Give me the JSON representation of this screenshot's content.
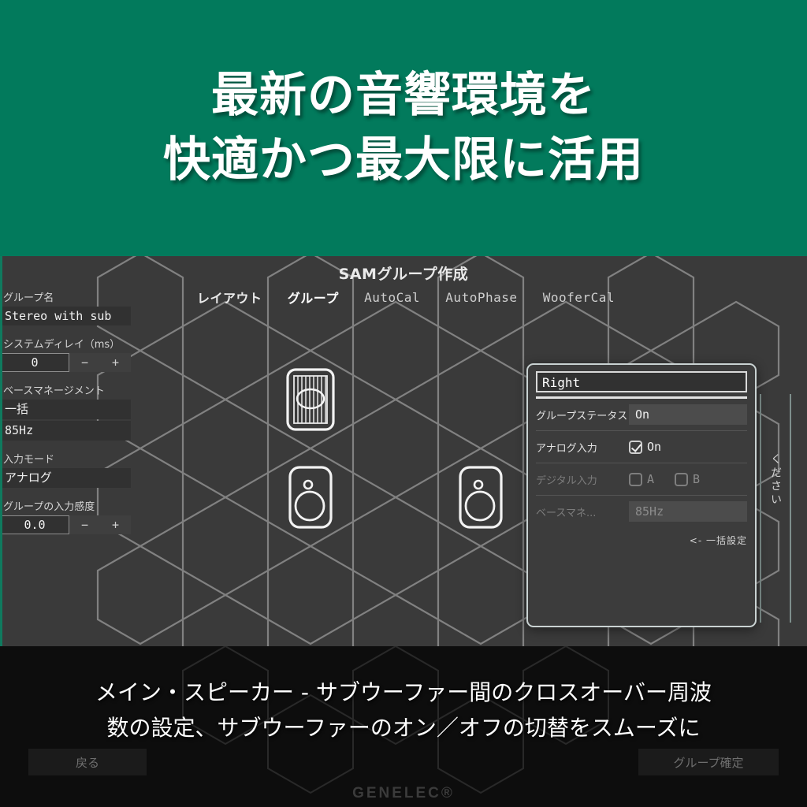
{
  "hero": {
    "line1": "最新の音響環境を",
    "line2": "快適かつ最大限に活用",
    "bg_color": "#027a5c",
    "text_color": "#ffffff"
  },
  "app": {
    "title": "SAMグループ作成",
    "tabs": [
      {
        "label": "レイアウト",
        "active": false,
        "script": "jp"
      },
      {
        "label": "グループ",
        "active": true,
        "script": "jp"
      },
      {
        "label": "AutoCal",
        "active": false,
        "script": "latin"
      },
      {
        "label": "AutoPhase",
        "active": false,
        "script": "latin"
      },
      {
        "label": "WooferCal",
        "active": false,
        "script": "latin"
      }
    ],
    "sidebar": {
      "group_name_label": "グループ名",
      "group_name_value": "Stereo with sub",
      "system_delay_label": "システムディレイ（ms）",
      "system_delay_value": "0",
      "minus": "−",
      "plus": "+",
      "bass_management_label": "ベースマネージメント",
      "bass_management_mode": "一括",
      "bass_management_freq": "85Hz",
      "input_mode_label": "入力モード",
      "input_mode_value": "アナログ",
      "group_sensitivity_label": "グループの入力感度",
      "group_sensitivity_value": "0.0"
    },
    "dialog": {
      "title": "Right",
      "group_status_label": "グループステータス",
      "group_status_value": "On",
      "analog_input_label": "アナログ入力",
      "analog_input_state": "On",
      "digital_input_label": "デジタル入力",
      "digital_a_label": "A",
      "digital_b_label": "B",
      "bass_management_label": "ベースマネ...",
      "bass_management_value": "85Hz",
      "batch_set_label": "<- 一括設定"
    },
    "side_note": "ください",
    "buttons": {
      "back": "戻る",
      "confirm": "グループ確定"
    },
    "brand": "GENELEC®",
    "speakers": [
      {
        "type": "subwoofer",
        "name": "sub"
      },
      {
        "type": "monitor",
        "name": "left"
      },
      {
        "type": "monitor",
        "name": "right"
      }
    ]
  },
  "caption": {
    "line1": "メイン・スピーカー - サブウーファー間のクロスオーバー周波",
    "line2": "数の設定、サブウーファーのオン／オフの切替をスムーズに"
  }
}
